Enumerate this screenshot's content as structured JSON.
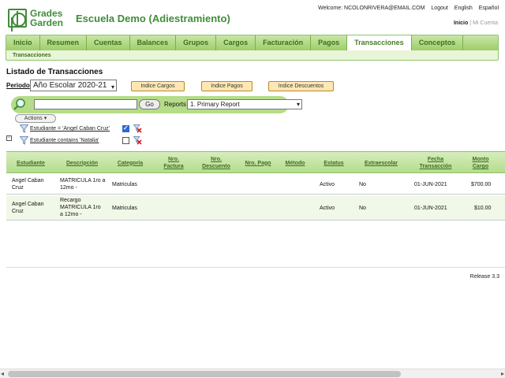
{
  "header": {
    "logo_line1": "Grades",
    "logo_line2": "Garden",
    "app_title": "Escuela Demo (Adiestramiento)",
    "welcome": "Welcome: NCOLONRIVERA@EMAIL.COM",
    "logout": "Logout",
    "lang_en": "English",
    "lang_es": "Español",
    "inicio": "Inicio",
    "separator": "|",
    "mi_cuenta": "Mi Cuenta"
  },
  "nav": {
    "tabs": [
      "Inicio",
      "Resumen",
      "Cuentas",
      "Balances",
      "Grupos",
      "Cargos",
      "Facturación",
      "Pagos",
      "Transacciones",
      "Conceptos"
    ],
    "active_tab": "Transacciones",
    "breadcrumb": "Transacciones"
  },
  "page": {
    "title": "Listado de Transacciones",
    "periodo_label": "Periodo",
    "periodo_value": "Año Escolar 2020-21",
    "indice_cargos": "Indice Cargos",
    "indice_pagos": "Indice Pagos",
    "indice_descuentos": "Indice Descuentos"
  },
  "search": {
    "value": "",
    "go_label": "Go",
    "reports_label": "Reports",
    "reports_value": "1. Primary Report",
    "actions_label": "Actions"
  },
  "filters": [
    {
      "text": "Estudiante = 'Angel Caban Cruz'",
      "checked": true
    },
    {
      "text": "Estudiante contains 'Natalia'",
      "checked": false
    }
  ],
  "grid": {
    "columns": [
      "Estudiante",
      "Descripción",
      "Categoría",
      "Nro. Factura",
      "Nro. Descuento",
      "Nro. Pago",
      "Método",
      "Estatus",
      "Extraescolar",
      "Fecha Transacción",
      "Monto Cargo"
    ],
    "rows": [
      {
        "estudiante": "Angel Caban Cruz",
        "descripcion": "MATRICULA 1ro a 12mo -",
        "categoria": "Matriculas",
        "factura": "",
        "descuento": "",
        "pago": "",
        "metodo": "",
        "estatus": "Activo",
        "extraescolar": "No",
        "fecha": "01-JUN-2021",
        "monto": "$700.00"
      },
      {
        "estudiante": "Angel Caban Cruz",
        "descripcion": "Recargo MATRICULA 1ro a 12mo -",
        "categoria": "Matriculas",
        "factura": "",
        "descuento": "",
        "pago": "",
        "metodo": "",
        "estatus": "Activo",
        "extraescolar": "No",
        "fecha": "01-JUN-2021",
        "monto": "$10.00"
      }
    ]
  },
  "footer": {
    "release": "Release 3.3"
  },
  "colors": {
    "brand_green": "#3f8d3a",
    "tab_bg": "#9fcd6b",
    "index_button": "#ffe7b5"
  }
}
